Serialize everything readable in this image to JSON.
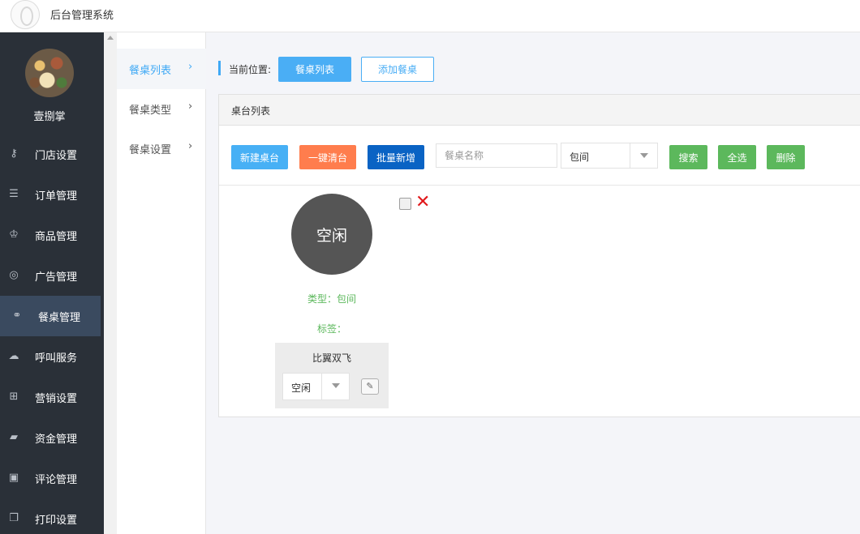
{
  "header": {
    "title": "后台管理系统"
  },
  "sidebar": {
    "username": "壹捌掌",
    "items": [
      {
        "label": "门店设置",
        "icon": "key-icon"
      },
      {
        "label": "订单管理",
        "icon": "list-icon"
      },
      {
        "label": "商品管理",
        "icon": "trophy-icon"
      },
      {
        "label": "广告管理",
        "icon": "lifebuoy-icon"
      },
      {
        "label": "餐桌管理",
        "icon": "binoculars-icon",
        "active": true
      },
      {
        "label": "呼叫服务",
        "icon": "cloud-icon"
      },
      {
        "label": "营销设置",
        "icon": "gift-icon"
      },
      {
        "label": "资金管理",
        "icon": "book-icon"
      },
      {
        "label": "评论管理",
        "icon": "money-icon"
      },
      {
        "label": "打印设置",
        "icon": "copy-icon"
      }
    ]
  },
  "subnav": {
    "items": [
      {
        "label": "餐桌列表",
        "active": true
      },
      {
        "label": "餐桌类型"
      },
      {
        "label": "餐桌设置"
      }
    ],
    "chevron": "›"
  },
  "breadcrumb": {
    "label": "当前位置:",
    "tab_active": "餐桌列表",
    "tab_add": "添加餐桌"
  },
  "panel": {
    "title": "桌台列表",
    "toolbar": {
      "new_btn": "新建桌台",
      "clear_btn": "一键清台",
      "batch_btn": "批量新增",
      "search_placeholder": "餐桌名称",
      "type_select": "包间",
      "search_btn": "搜索",
      "select_all_btn": "全选",
      "delete_btn": "删除"
    }
  },
  "table_card": {
    "status": "空闲",
    "type_line": "类型：包间",
    "tag_line": "标签：",
    "name": "比翼双飞",
    "status_select": "空闲",
    "delete_mark": "✕",
    "edit_mark": "✎"
  },
  "colors": {
    "accent": "#3fa9f5",
    "orange": "#ff7d4d",
    "dark_blue": "#0a63c4",
    "green": "#5cb85c",
    "sidebar_bg": "#2a3038"
  }
}
